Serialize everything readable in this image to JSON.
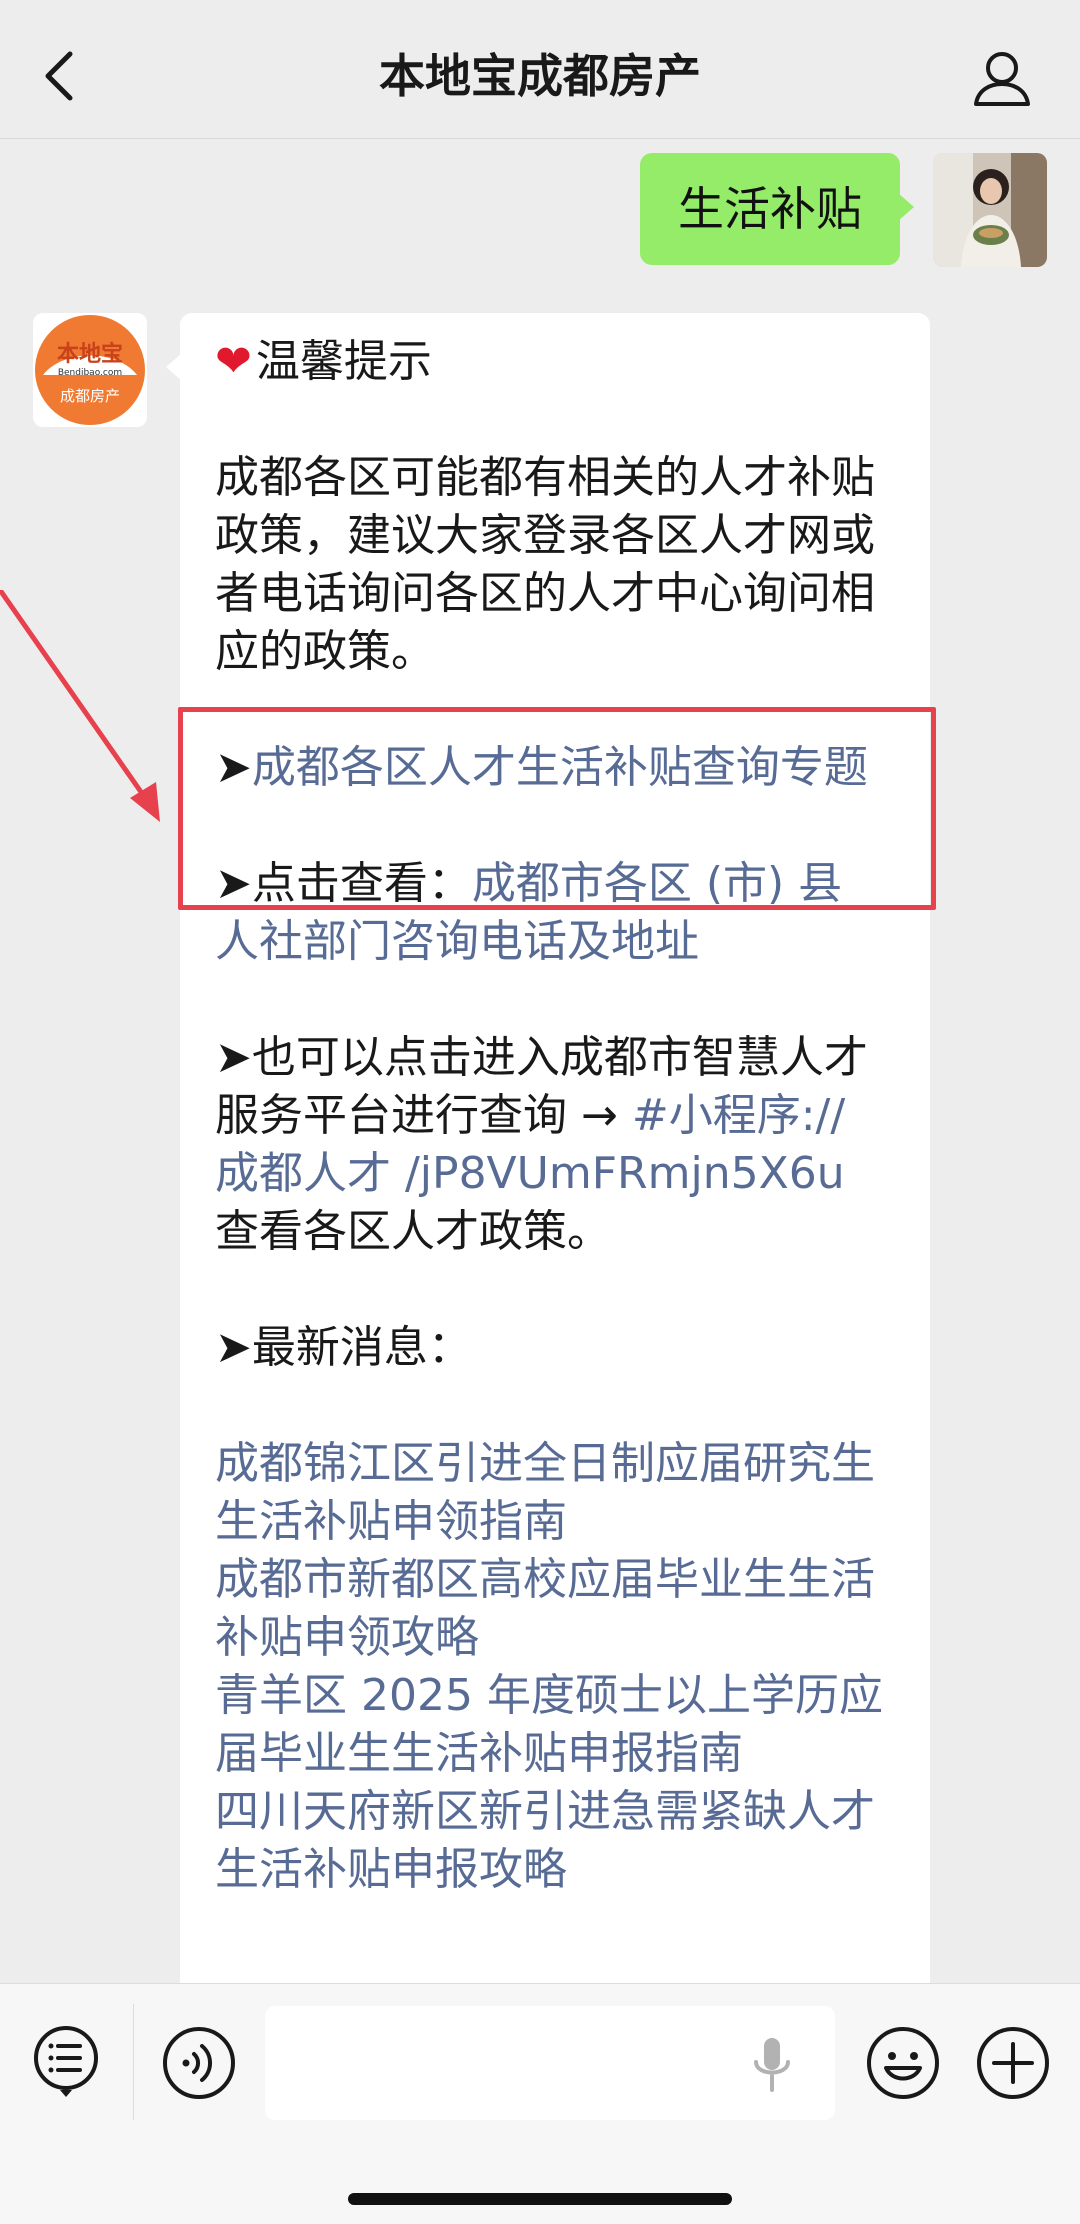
{
  "header": {
    "title": "本地宝成都房产"
  },
  "chat": {
    "sent_message": "生活补贴",
    "bot_avatar": {
      "brand": "本地宝",
      "domain": "Bendibao.com",
      "caption": "成都房产",
      "color": "#f07a32"
    },
    "received": {
      "tip_title": "温馨提示",
      "intro": "成都各区可能都有相关的人才补贴政策，建议大家登录各区人才网或者电话询问各区的人才中心询问相应的政策。",
      "arrow_prefix": "➤",
      "topic_link": "成都各区人才生活补贴查询专题",
      "check_label": "点击查看：",
      "hr_link": "成都市各区 (市) 县人社部门咨询电话及地址",
      "platform_text": "也可以点击进入成都市智慧人才服务平台进行查询 → ",
      "miniapp_link": "#小程序://成都人才 /jP8VUmFRmjn5X6u",
      "platform_suffix": "查看各区人才政策。",
      "news_label": "最新消息：",
      "news_links": [
        "成都锦江区引进全日制应届研究生生活补贴申领指南",
        "成都市新都区高校应届毕业生生活补贴申领攻略",
        "青羊区 2025 年度硕士以上学历应届毕业生生活补贴申报指南",
        "四川天府新区新引进急需紧缺人才生活补贴申报攻略"
      ]
    }
  },
  "colors": {
    "sent_bubble": "#95ec69",
    "link": "#576b95",
    "highlight": "#e8414e",
    "background": "#ededed"
  },
  "icons": [
    "back-icon",
    "person-icon",
    "menu-icon",
    "voice-icon",
    "mic-icon",
    "emoji-icon",
    "plus-icon"
  ]
}
